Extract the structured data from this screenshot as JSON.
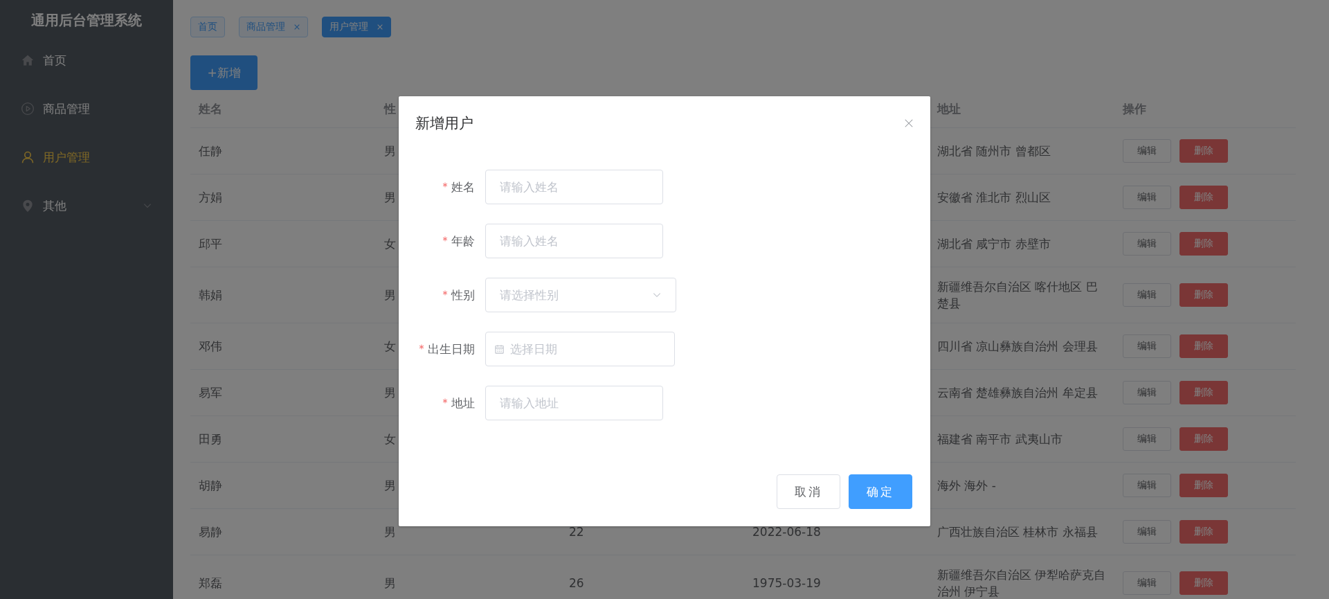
{
  "sidebar": {
    "title": "通用后台管理系统",
    "items": [
      {
        "label": "首页",
        "selected": false,
        "kind": "item"
      },
      {
        "label": "商品管理",
        "selected": false,
        "kind": "item"
      },
      {
        "label": "用户管理",
        "selected": true,
        "kind": "item"
      },
      {
        "label": "其他",
        "selected": false,
        "kind": "submenu",
        "expanded": false
      }
    ]
  },
  "tags": [
    {
      "label": "首页",
      "closable": false,
      "selected": false
    },
    {
      "label": "商品管理",
      "closable": true,
      "selected": false
    },
    {
      "label": "用户管理",
      "closable": true,
      "selected": true
    }
  ],
  "add_button": "+新增",
  "table": {
    "columns": [
      "姓名",
      "性",
      "",
      "",
      "地址",
      "操作"
    ],
    "rows": [
      {
        "name": "任静",
        "gender": "男",
        "address": "湖北省 随州市 曾都区",
        "actions": [
          {
            "label": "编辑",
            "kind": "default"
          },
          {
            "label": "删除",
            "kind": "danger"
          }
        ]
      },
      {
        "name": "方娟",
        "gender": "男",
        "address": "安徽省 淮北市 烈山区",
        "actions": [
          {
            "label": "编辑",
            "kind": "default"
          },
          {
            "label": "删除",
            "kind": "danger"
          }
        ]
      },
      {
        "name": "邱平",
        "gender": "女",
        "address": "湖北省 咸宁市 赤壁市",
        "actions": [
          {
            "label": "编辑",
            "kind": "default"
          },
          {
            "label": "删除",
            "kind": "danger"
          }
        ]
      },
      {
        "name": "韩娟",
        "gender": "男",
        "address": "新疆维吾尔自治区 喀什地区 巴楚县",
        "actions": [
          {
            "label": "编辑",
            "kind": "default"
          },
          {
            "label": "删除",
            "kind": "danger"
          }
        ]
      },
      {
        "name": "邓伟",
        "gender": "女",
        "address": "四川省 凉山彝族自治州 会理县",
        "actions": [
          {
            "label": "编辑",
            "kind": "default"
          },
          {
            "label": "删除",
            "kind": "danger"
          }
        ]
      },
      {
        "name": "易军",
        "gender": "男",
        "address": "云南省 楚雄彝族自治州 牟定县",
        "actions": [
          {
            "label": "编辑",
            "kind": "default"
          },
          {
            "label": "删除",
            "kind": "danger"
          }
        ]
      },
      {
        "name": "田勇",
        "gender": "女",
        "address": "福建省 南平市 武夷山市",
        "actions": [
          {
            "label": "编辑",
            "kind": "default"
          },
          {
            "label": "删除",
            "kind": "danger"
          }
        ]
      },
      {
        "name": "胡静",
        "gender": "男",
        "address": "海外 海外 -",
        "actions": [
          {
            "label": "编辑",
            "kind": "default"
          },
          {
            "label": "删除",
            "kind": "danger"
          }
        ]
      },
      {
        "name": "易静",
        "gender": "男",
        "age": "22",
        "birth": "2022-06-18",
        "address": "广西壮族自治区 桂林市 永福县",
        "actions": [
          {
            "label": "编辑",
            "kind": "default"
          },
          {
            "label": "删除",
            "kind": "danger"
          }
        ]
      },
      {
        "name": "郑磊",
        "gender": "男",
        "age": "26",
        "birth": "1975-03-19",
        "address": "新疆维吾尔自治区 伊犁哈萨克自治州 伊宁县",
        "actions": [
          {
            "label": "编辑",
            "kind": "default"
          },
          {
            "label": "删除",
            "kind": "danger"
          }
        ]
      }
    ]
  },
  "dialog": {
    "title": "新增用户",
    "fields": [
      {
        "label": "姓名",
        "required": true,
        "kind": "text",
        "placeholder": "请输入姓名"
      },
      {
        "label": "年龄",
        "required": true,
        "kind": "text",
        "placeholder": "请输入姓名"
      },
      {
        "label": "性别",
        "required": true,
        "kind": "select",
        "placeholder": "请选择性别"
      },
      {
        "label": "出生日期",
        "required": true,
        "kind": "date",
        "placeholder": "选择日期"
      },
      {
        "label": "地址",
        "required": true,
        "kind": "text",
        "placeholder": "请输入地址"
      }
    ],
    "buttons": [
      {
        "label": "取消",
        "kind": "default"
      },
      {
        "label": "确定",
        "kind": "primary"
      }
    ]
  }
}
